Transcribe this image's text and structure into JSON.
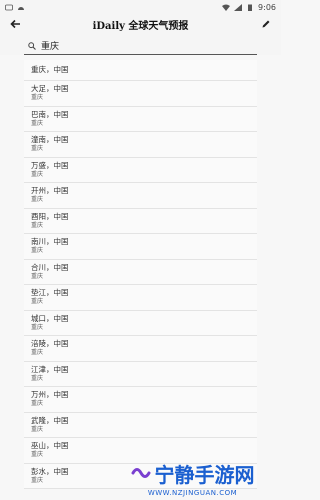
{
  "status_bar": {
    "time": "9:06"
  },
  "header": {
    "title": "iDaily 全球天气预报"
  },
  "search": {
    "value": "重庆"
  },
  "results": [
    {
      "name": "重庆，中国",
      "sub": ""
    },
    {
      "name": "大足，中国",
      "sub": "重庆"
    },
    {
      "name": "巴南，中国",
      "sub": "重庆"
    },
    {
      "name": "潼南，中国",
      "sub": "重庆"
    },
    {
      "name": "万盛，中国",
      "sub": "重庆"
    },
    {
      "name": "开州，中国",
      "sub": "重庆"
    },
    {
      "name": "酉阳，中国",
      "sub": "重庆"
    },
    {
      "name": "南川，中国",
      "sub": "重庆"
    },
    {
      "name": "合川，中国",
      "sub": "重庆"
    },
    {
      "name": "垫江，中国",
      "sub": "重庆"
    },
    {
      "name": "城口，中国",
      "sub": "重庆"
    },
    {
      "name": "涪陵，中国",
      "sub": "重庆"
    },
    {
      "name": "江津，中国",
      "sub": "重庆"
    },
    {
      "name": "万州，中国",
      "sub": "重庆"
    },
    {
      "name": "武隆，中国",
      "sub": "重庆"
    },
    {
      "name": "巫山，中国",
      "sub": "重庆"
    },
    {
      "name": "彭水，中国",
      "sub": "重庆"
    }
  ],
  "watermark": {
    "title": "宁静手游网",
    "url": "WWW.NZJINGUAN.COM"
  },
  "colors": {
    "watermark": "#1a5fd0"
  }
}
